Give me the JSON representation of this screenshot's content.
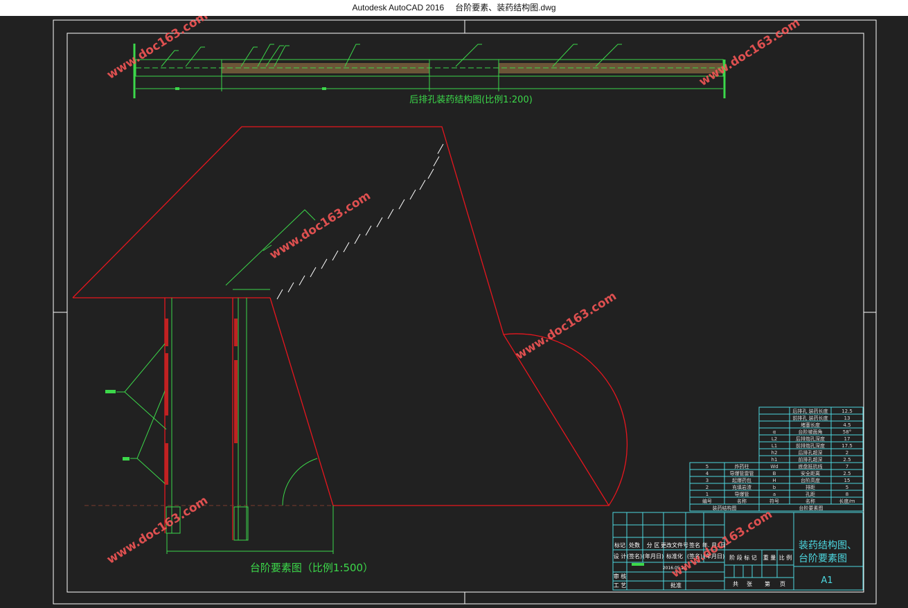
{
  "window": {
    "app_title": "Autodesk AutoCAD 2016",
    "file_name": "台阶要素、装药结构图.dwg"
  },
  "colors": {
    "background": "#212121",
    "frame": "#ffffff",
    "bench": "#e8161e",
    "dimension": "#3cd84a",
    "table": "#4dd7e0",
    "watermark": "#ff5858"
  },
  "drawings": {
    "charge_title": "后排孔装药结构图(比例1:200)",
    "bench_title": "台阶要素图（比例1:500）"
  },
  "watermark": "www.doc163.com",
  "param_table": {
    "rows": [
      {
        "sym": "",
        "name": "后排孔 装药长度",
        "val": "12.5"
      },
      {
        "sym": "",
        "name": "前排孔 装药长度",
        "val": "13"
      },
      {
        "sym": "",
        "name": "堵塞长度",
        "val": "4.5"
      },
      {
        "sym": "α",
        "name": "台阶坡面角",
        "val": "58°"
      },
      {
        "sym": "L2",
        "name": "后排炮孔深度",
        "val": "17"
      },
      {
        "sym": "L1",
        "name": "前排炮孔深度",
        "val": "17.5"
      },
      {
        "sym": "h2",
        "name": "后排孔超深",
        "val": "2"
      },
      {
        "sym": "h1",
        "name": "前排孔超深",
        "val": "2.5"
      },
      {
        "sym": "Wd",
        "name": "底盘抵抗线",
        "val": "7"
      },
      {
        "sym": "B",
        "name": "安全距离",
        "val": "2.5"
      },
      {
        "sym": "H",
        "name": "台阶高度",
        "val": "15"
      },
      {
        "sym": "b",
        "name": "排距",
        "val": "5"
      },
      {
        "sym": "a",
        "name": "孔距",
        "val": "8"
      }
    ],
    "header": {
      "sym": "符号",
      "name": "名称",
      "val": "长度/m"
    },
    "caption": "台阶要素图"
  },
  "legend_table": {
    "rows": [
      {
        "num": "5",
        "name": "炸药柱"
      },
      {
        "num": "4",
        "name": "导爆管雷管"
      },
      {
        "num": "3",
        "name": "起爆药包"
      },
      {
        "num": "2",
        "name": "充填岩渣"
      },
      {
        "num": "1",
        "name": "导爆管"
      }
    ],
    "header": {
      "num": "编号",
      "name": "名称"
    },
    "caption": "装药结构图"
  },
  "title_block": {
    "sign_headers": [
      "标记",
      "处数",
      "分 区",
      "更改文件号",
      "签名",
      "年. 月. 日"
    ],
    "design_row": [
      "设 计",
      "(签名)",
      "(年月日)",
      "标准化",
      "(签名)",
      "(年月日)"
    ],
    "design_date": "2016.05.20",
    "rows_left": [
      "审 核",
      "工 艺"
    ],
    "approve_label": "批准",
    "stage_headers": [
      "阶 段 标 记",
      "重 量",
      "比 例"
    ],
    "sheet_info": [
      "共",
      "张",
      "第",
      "页"
    ],
    "drawing_name_line1": "装药结构图、",
    "drawing_name_line2": "台阶要素图",
    "sheet_size": "A1"
  }
}
